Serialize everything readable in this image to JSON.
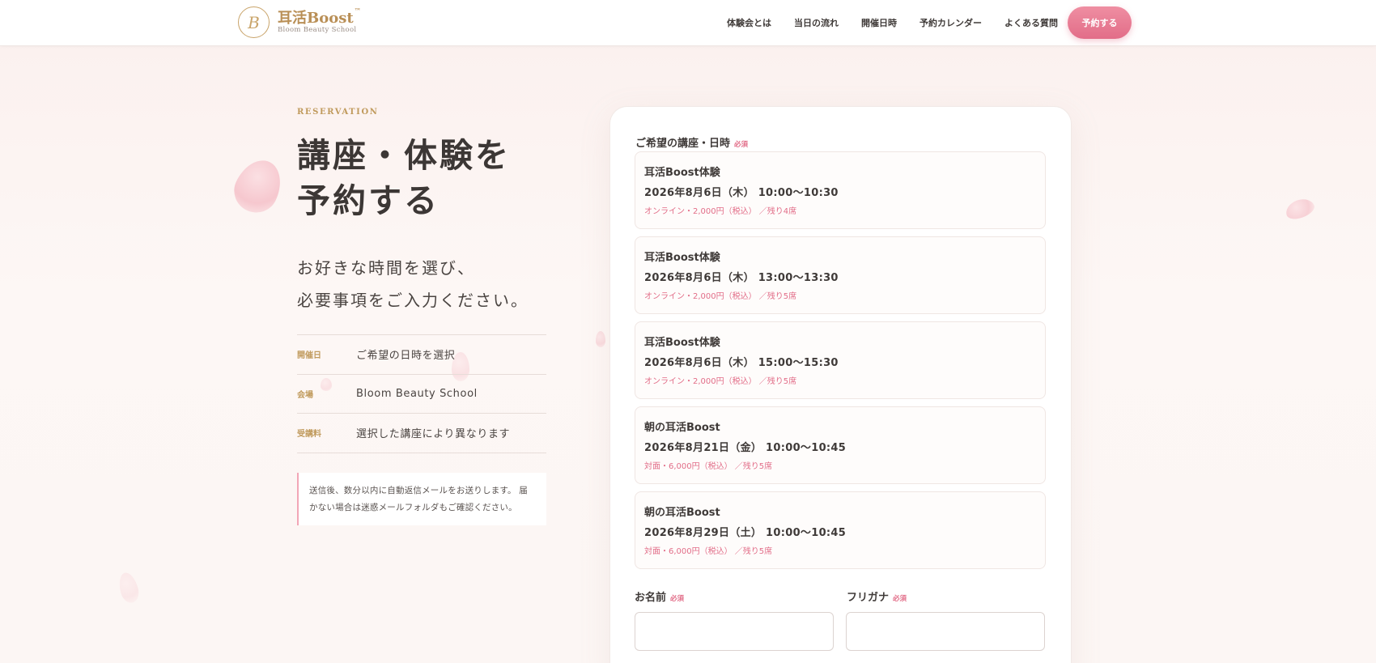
{
  "header": {
    "logo_mark": "B",
    "logo_title": "耳活Boost",
    "logo_tm": "™",
    "logo_sub": "Bloom Beauty School",
    "nav": [
      "体験会とは",
      "当日の流れ",
      "開催日時",
      "予約カレンダー",
      "よくある質問"
    ],
    "cta": "予約する"
  },
  "intro": {
    "eyebrow": "RESERVATION",
    "title_line1": "講座・体験を",
    "title_line2": "予約する",
    "lead_line1": "お好きな時間を選び、",
    "lead_line2": "必要事項をご入力ください。",
    "info": [
      {
        "label": "開催日",
        "value": "ご希望の日時を選択"
      },
      {
        "label": "会場",
        "value": "Bloom Beauty School"
      },
      {
        "label": "受講料",
        "value": "選択した講座により異なります"
      }
    ],
    "note_line1": "送信後、数分以内に自動返信メールをお送りします。 届",
    "note_line2": "かない場合は迷惑メールフォルダもご確認ください。"
  },
  "form": {
    "slot_label": "ご希望の講座・日時",
    "required": "必須",
    "slots": [
      {
        "title": "耳活Boost体験",
        "date": "2026年8月6日（木） 10:00〜10:30",
        "meta": "オンライン・2,000円（税込） ／残り4席"
      },
      {
        "title": "耳活Boost体験",
        "date": "2026年8月6日（木） 13:00〜13:30",
        "meta": "オンライン・2,000円（税込） ／残り5席"
      },
      {
        "title": "耳活Boost体験",
        "date": "2026年8月6日（木） 15:00〜15:30",
        "meta": "オンライン・2,000円（税込） ／残り5席"
      },
      {
        "title": "朝の耳活Boost",
        "date": "2026年8月21日（金） 10:00〜10:45",
        "meta": "対面・6,000円（税込） ／残り5席"
      },
      {
        "title": "朝の耳活Boost",
        "date": "2026年8月29日（土） 10:00〜10:45",
        "meta": "対面・6,000円（税込） ／残り5席"
      }
    ],
    "name_label": "お名前",
    "kana_label": "フリガナ",
    "name_value": "",
    "kana_value": ""
  }
}
